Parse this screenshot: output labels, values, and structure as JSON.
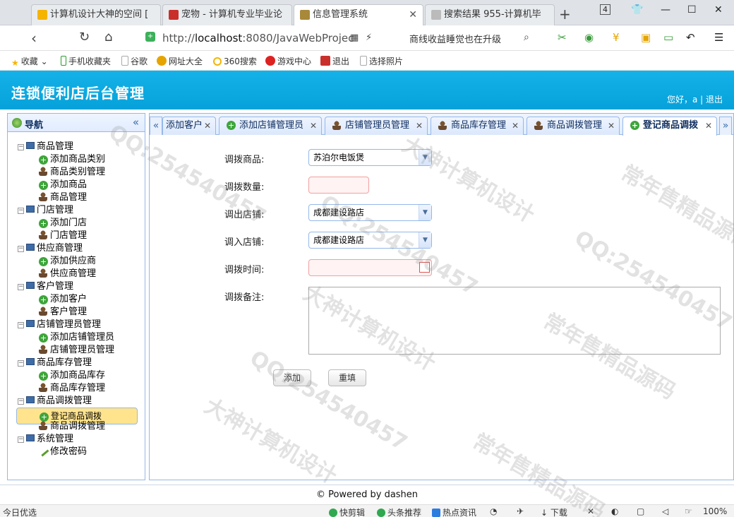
{
  "browser": {
    "tabs": [
      {
        "label": "计算机设计大神的空间 [",
        "fav_color": "#f5b400"
      },
      {
        "label": "宠物 - 计算机专业毕业论",
        "fav_color": "#c9302c"
      },
      {
        "label": "信息管理系统",
        "fav_color": "#a8893a"
      },
      {
        "label": "搜索结果 955-计算机毕",
        "fav_color": "#999999"
      }
    ],
    "tab_count": "4",
    "url_host": "http://",
    "url_bold": "localhost",
    "url_rest": ":8080/JavaWebProjec",
    "search_text": "商线收益睡觉也在升级",
    "bookmarks": [
      "收藏",
      "手机收藏夹",
      "谷歌",
      "网址大全",
      "360搜索",
      "游戏中心",
      "退出",
      "选择照片"
    ]
  },
  "app": {
    "title": "连锁便利店后台管理",
    "welcome": "您好，a",
    "logout": "退出"
  },
  "nav": {
    "title": "导航",
    "groups": [
      {
        "label": "商品管理",
        "items": [
          "添加商品类别",
          "商品类别管理",
          "添加商品",
          "商品管理"
        ]
      },
      {
        "label": "门店管理",
        "items": [
          "添加门店",
          "门店管理"
        ]
      },
      {
        "label": "供应商管理",
        "items": [
          "添加供应商",
          "供应商管理"
        ]
      },
      {
        "label": "客户管理",
        "items": [
          "添加客户",
          "客户管理"
        ]
      },
      {
        "label": "店铺管理员管理",
        "items": [
          "添加店铺管理员",
          "店铺管理员管理"
        ]
      },
      {
        "label": "商品库存管理",
        "items": [
          "添加商品库存",
          "商品库存管理"
        ]
      },
      {
        "label": "商品调拨管理",
        "items": [
          "登记商品调拨",
          "商品调拨管理"
        ]
      },
      {
        "label": "系统管理",
        "items": [
          "修改密码"
        ]
      }
    ]
  },
  "tabs": [
    "添加客户",
    "添加店铺管理员",
    "店铺管理员管理",
    "商品库存管理",
    "商品调拨管理",
    "登记商品调拨"
  ],
  "form": {
    "goods_label": "调拨商品:",
    "goods_value": "苏泊尔电饭煲",
    "qty_label": "调拨数量:",
    "qty_value": "",
    "out_label": "调出店铺:",
    "out_value": "成都建设路店",
    "in_label": "调入店铺:",
    "in_value": "成都建设路店",
    "time_label": "调拨时间:",
    "time_value": "",
    "memo_label": "调拨备注:",
    "memo_value": "",
    "add_btn": "添加",
    "reset_btn": "重填"
  },
  "footer": "© Powered by dashen",
  "statusbar": {
    "left": "今日优选",
    "items": [
      "快剪辑",
      "头条推荐",
      "热点资讯",
      "下载"
    ],
    "zoom": "100%"
  },
  "watermarks": [
    "QQ:254540457",
    "大神计算机设计",
    "常年售精品源码",
    "QQ:254540457",
    "大神计算机设计",
    "常年售精品源码",
    "QQ:254540457",
    "常年售精品源码",
    "QQ:254540457",
    "大神计算机设计"
  ]
}
